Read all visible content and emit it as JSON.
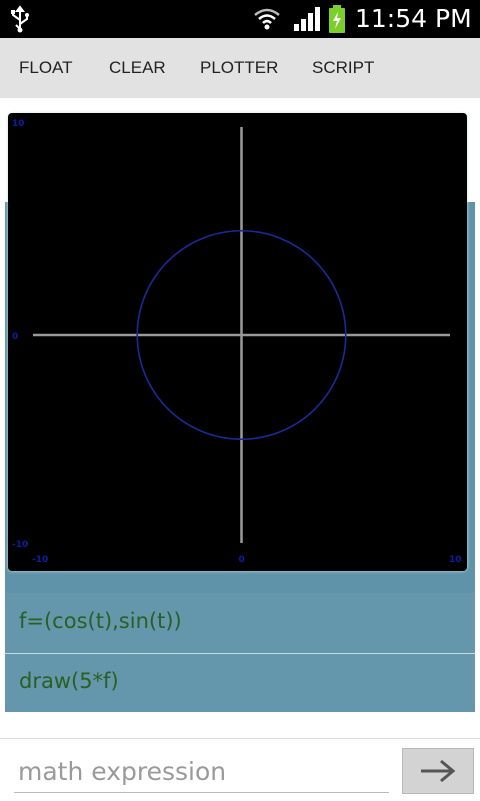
{
  "status_bar": {
    "time": "11:54 PM",
    "icons": [
      "usb-icon",
      "wifi-icon",
      "signal-icon",
      "battery-charging-icon"
    ]
  },
  "toolbar": {
    "buttons": [
      "FLOAT",
      "CLEAR",
      "PLOTTER",
      "SCRIPT"
    ]
  },
  "history": {
    "rows": [
      {
        "expression": "f=(cos(t),sin(t))"
      },
      {
        "expression": "draw(5*f)"
      }
    ]
  },
  "chart_data": {
    "type": "line",
    "title": "",
    "xlabel": "",
    "ylabel": "",
    "xlim": [
      -10,
      10
    ],
    "ylim": [
      -10,
      10
    ],
    "x_ticks": [
      "-10",
      "0",
      "10"
    ],
    "y_ticks": [
      "10",
      "0",
      "-10"
    ],
    "grid": false,
    "axis_color": "#9a9a9a",
    "tick_label_color": "#0a1ea8",
    "series": [
      {
        "function": "5*(cos(t),sin(t))",
        "radius": 5,
        "center": [
          0,
          0
        ],
        "color": "#1a2a9a"
      }
    ]
  },
  "input": {
    "placeholder": "math expression",
    "value": ""
  },
  "send_button": {
    "icon": "arrow-right-icon"
  }
}
